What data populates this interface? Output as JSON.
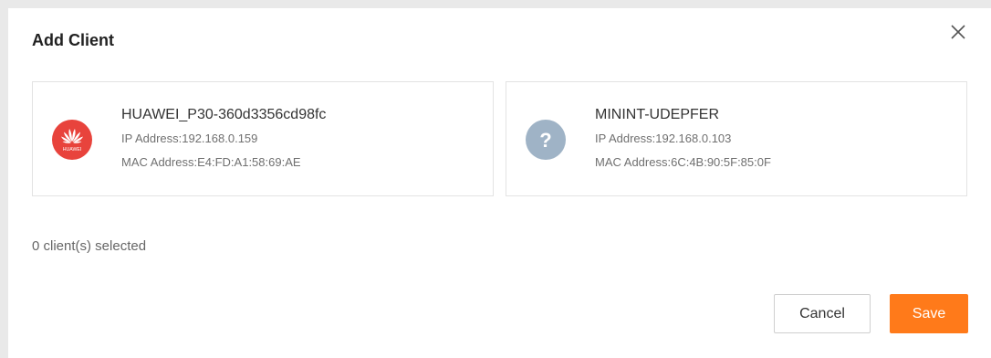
{
  "dialog": {
    "title": "Add Client",
    "close_icon": "close-icon"
  },
  "clients": [
    {
      "name": "HUAWEI_P30-360d3356cd98fc",
      "ip": "IP Address:192.168.0.159",
      "mac": "MAC Address:E4:FD:A1:58:69:AE",
      "icon": "huawei-logo-icon",
      "logo_text": "HUAWEI",
      "icon_color": "#e8433c"
    },
    {
      "name": "MININT-UDEPFER",
      "ip": "IP Address:192.168.0.103",
      "mac": "MAC Address:6C:4B:90:5F:85:0F",
      "icon": "unknown-device-icon",
      "icon_glyph": "?",
      "icon_color": "#9fb3c6"
    }
  ],
  "selection": {
    "count_text": "0 client(s) selected"
  },
  "footer": {
    "cancel_label": "Cancel",
    "save_label": "Save",
    "accent_color": "#ff7a1a"
  }
}
